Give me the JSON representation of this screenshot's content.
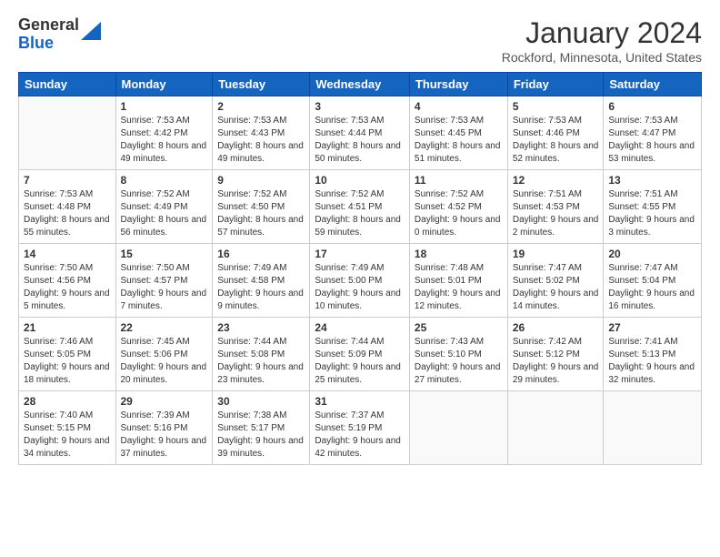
{
  "logo": {
    "general": "General",
    "blue": "Blue"
  },
  "title": "January 2024",
  "location": "Rockford, Minnesota, United States",
  "weekdays": [
    "Sunday",
    "Monday",
    "Tuesday",
    "Wednesday",
    "Thursday",
    "Friday",
    "Saturday"
  ],
  "weeks": [
    [
      {
        "day": "",
        "sunrise": "",
        "sunset": "",
        "daylight": ""
      },
      {
        "day": "1",
        "sunrise": "Sunrise: 7:53 AM",
        "sunset": "Sunset: 4:42 PM",
        "daylight": "Daylight: 8 hours and 49 minutes."
      },
      {
        "day": "2",
        "sunrise": "Sunrise: 7:53 AM",
        "sunset": "Sunset: 4:43 PM",
        "daylight": "Daylight: 8 hours and 49 minutes."
      },
      {
        "day": "3",
        "sunrise": "Sunrise: 7:53 AM",
        "sunset": "Sunset: 4:44 PM",
        "daylight": "Daylight: 8 hours and 50 minutes."
      },
      {
        "day": "4",
        "sunrise": "Sunrise: 7:53 AM",
        "sunset": "Sunset: 4:45 PM",
        "daylight": "Daylight: 8 hours and 51 minutes."
      },
      {
        "day": "5",
        "sunrise": "Sunrise: 7:53 AM",
        "sunset": "Sunset: 4:46 PM",
        "daylight": "Daylight: 8 hours and 52 minutes."
      },
      {
        "day": "6",
        "sunrise": "Sunrise: 7:53 AM",
        "sunset": "Sunset: 4:47 PM",
        "daylight": "Daylight: 8 hours and 53 minutes."
      }
    ],
    [
      {
        "day": "7",
        "sunrise": "Sunrise: 7:53 AM",
        "sunset": "Sunset: 4:48 PM",
        "daylight": "Daylight: 8 hours and 55 minutes."
      },
      {
        "day": "8",
        "sunrise": "Sunrise: 7:52 AM",
        "sunset": "Sunset: 4:49 PM",
        "daylight": "Daylight: 8 hours and 56 minutes."
      },
      {
        "day": "9",
        "sunrise": "Sunrise: 7:52 AM",
        "sunset": "Sunset: 4:50 PM",
        "daylight": "Daylight: 8 hours and 57 minutes."
      },
      {
        "day": "10",
        "sunrise": "Sunrise: 7:52 AM",
        "sunset": "Sunset: 4:51 PM",
        "daylight": "Daylight: 8 hours and 59 minutes."
      },
      {
        "day": "11",
        "sunrise": "Sunrise: 7:52 AM",
        "sunset": "Sunset: 4:52 PM",
        "daylight": "Daylight: 9 hours and 0 minutes."
      },
      {
        "day": "12",
        "sunrise": "Sunrise: 7:51 AM",
        "sunset": "Sunset: 4:53 PM",
        "daylight": "Daylight: 9 hours and 2 minutes."
      },
      {
        "day": "13",
        "sunrise": "Sunrise: 7:51 AM",
        "sunset": "Sunset: 4:55 PM",
        "daylight": "Daylight: 9 hours and 3 minutes."
      }
    ],
    [
      {
        "day": "14",
        "sunrise": "Sunrise: 7:50 AM",
        "sunset": "Sunset: 4:56 PM",
        "daylight": "Daylight: 9 hours and 5 minutes."
      },
      {
        "day": "15",
        "sunrise": "Sunrise: 7:50 AM",
        "sunset": "Sunset: 4:57 PM",
        "daylight": "Daylight: 9 hours and 7 minutes."
      },
      {
        "day": "16",
        "sunrise": "Sunrise: 7:49 AM",
        "sunset": "Sunset: 4:58 PM",
        "daylight": "Daylight: 9 hours and 9 minutes."
      },
      {
        "day": "17",
        "sunrise": "Sunrise: 7:49 AM",
        "sunset": "Sunset: 5:00 PM",
        "daylight": "Daylight: 9 hours and 10 minutes."
      },
      {
        "day": "18",
        "sunrise": "Sunrise: 7:48 AM",
        "sunset": "Sunset: 5:01 PM",
        "daylight": "Daylight: 9 hours and 12 minutes."
      },
      {
        "day": "19",
        "sunrise": "Sunrise: 7:47 AM",
        "sunset": "Sunset: 5:02 PM",
        "daylight": "Daylight: 9 hours and 14 minutes."
      },
      {
        "day": "20",
        "sunrise": "Sunrise: 7:47 AM",
        "sunset": "Sunset: 5:04 PM",
        "daylight": "Daylight: 9 hours and 16 minutes."
      }
    ],
    [
      {
        "day": "21",
        "sunrise": "Sunrise: 7:46 AM",
        "sunset": "Sunset: 5:05 PM",
        "daylight": "Daylight: 9 hours and 18 minutes."
      },
      {
        "day": "22",
        "sunrise": "Sunrise: 7:45 AM",
        "sunset": "Sunset: 5:06 PM",
        "daylight": "Daylight: 9 hours and 20 minutes."
      },
      {
        "day": "23",
        "sunrise": "Sunrise: 7:44 AM",
        "sunset": "Sunset: 5:08 PM",
        "daylight": "Daylight: 9 hours and 23 minutes."
      },
      {
        "day": "24",
        "sunrise": "Sunrise: 7:44 AM",
        "sunset": "Sunset: 5:09 PM",
        "daylight": "Daylight: 9 hours and 25 minutes."
      },
      {
        "day": "25",
        "sunrise": "Sunrise: 7:43 AM",
        "sunset": "Sunset: 5:10 PM",
        "daylight": "Daylight: 9 hours and 27 minutes."
      },
      {
        "day": "26",
        "sunrise": "Sunrise: 7:42 AM",
        "sunset": "Sunset: 5:12 PM",
        "daylight": "Daylight: 9 hours and 29 minutes."
      },
      {
        "day": "27",
        "sunrise": "Sunrise: 7:41 AM",
        "sunset": "Sunset: 5:13 PM",
        "daylight": "Daylight: 9 hours and 32 minutes."
      }
    ],
    [
      {
        "day": "28",
        "sunrise": "Sunrise: 7:40 AM",
        "sunset": "Sunset: 5:15 PM",
        "daylight": "Daylight: 9 hours and 34 minutes."
      },
      {
        "day": "29",
        "sunrise": "Sunrise: 7:39 AM",
        "sunset": "Sunset: 5:16 PM",
        "daylight": "Daylight: 9 hours and 37 minutes."
      },
      {
        "day": "30",
        "sunrise": "Sunrise: 7:38 AM",
        "sunset": "Sunset: 5:17 PM",
        "daylight": "Daylight: 9 hours and 39 minutes."
      },
      {
        "day": "31",
        "sunrise": "Sunrise: 7:37 AM",
        "sunset": "Sunset: 5:19 PM",
        "daylight": "Daylight: 9 hours and 42 minutes."
      },
      {
        "day": "",
        "sunrise": "",
        "sunset": "",
        "daylight": ""
      },
      {
        "day": "",
        "sunrise": "",
        "sunset": "",
        "daylight": ""
      },
      {
        "day": "",
        "sunrise": "",
        "sunset": "",
        "daylight": ""
      }
    ]
  ]
}
